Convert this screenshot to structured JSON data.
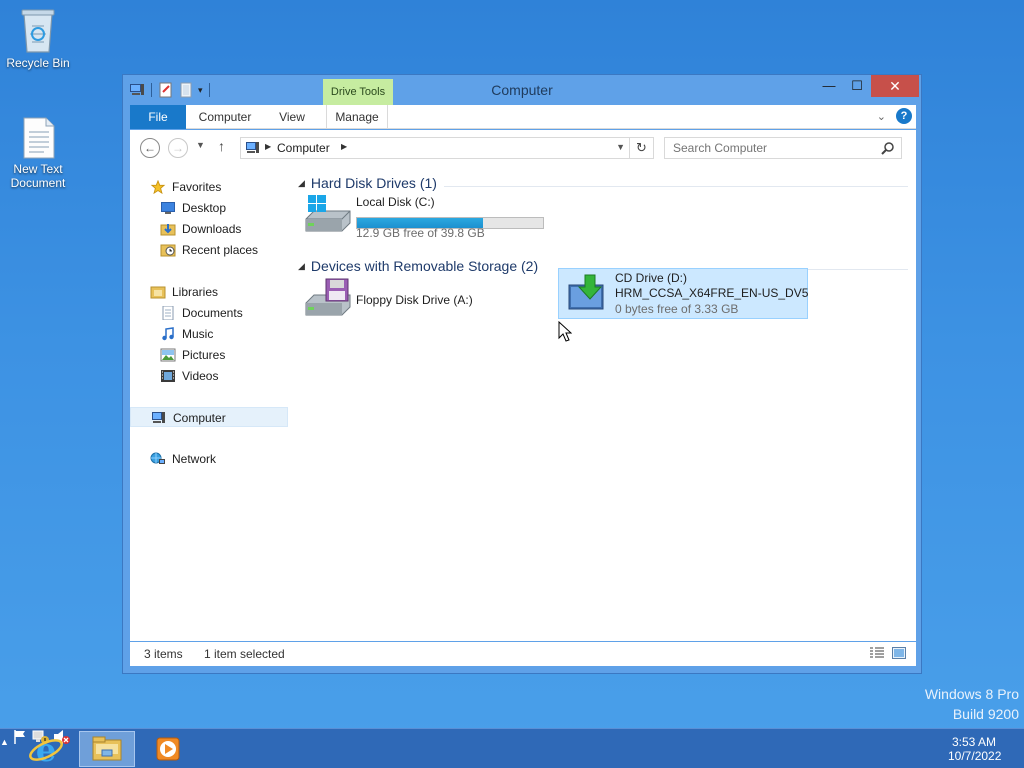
{
  "desktop": {
    "recycle_bin": "Recycle Bin",
    "text_document_line1": "New Text",
    "text_document_line2": "Document"
  },
  "window": {
    "title": "Computer",
    "contextual_tab": "Drive Tools",
    "close_glyph": "✕",
    "minimize_glyph": "—",
    "maximize_glyph": "☐"
  },
  "ribbon": {
    "tabs": [
      "File",
      "Computer",
      "View",
      "Manage"
    ],
    "help_glyph": "?"
  },
  "address": {
    "crumb": "Computer",
    "search_placeholder": "Search Computer"
  },
  "navpane": {
    "favorites": "Favorites",
    "desktop": "Desktop",
    "downloads": "Downloads",
    "recent": "Recent places",
    "libraries": "Libraries",
    "documents": "Documents",
    "music": "Music",
    "pictures": "Pictures",
    "videos": "Videos",
    "computer": "Computer",
    "network": "Network"
  },
  "groups": {
    "hdd": "Hard Disk Drives (1)",
    "removable": "Devices with Removable Storage (2)"
  },
  "drives": {
    "c": {
      "name": "Local Disk (C:)",
      "free": "12.9 GB free of 39.8 GB",
      "used_fraction": 0.676
    },
    "a": {
      "name": "Floppy Disk Drive (A:)"
    },
    "d": {
      "name": "CD Drive (D:)",
      "label": "HRM_CCSA_X64FRE_EN-US_DV5",
      "free": "0 bytes free of 3.33 GB"
    }
  },
  "status": {
    "items": "3 items",
    "selected": "1 item selected"
  },
  "branding": {
    "edition": "Windows 8 Pro",
    "build": "Build 9200"
  },
  "clock": {
    "time": "3:53 AM",
    "date": "10/7/2022"
  },
  "colors": {
    "accent": "#1979ca",
    "selection": "#cce8ff",
    "close": "#c7504a",
    "drive_tools": "#c6eca0"
  }
}
